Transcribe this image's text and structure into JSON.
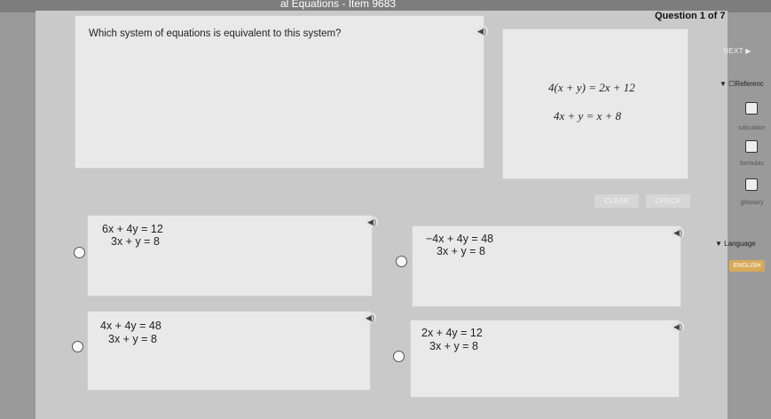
{
  "header": {
    "title": "al Equations - Item 9683",
    "question_counter": "Question 1 of 7"
  },
  "question": {
    "prompt": "Which system of equations is equivalent to this system?",
    "given": {
      "line1": "4(x + y) = 2x + 12",
      "line2": "4x + y = x + 8"
    }
  },
  "options": [
    {
      "line1": "6x + 4y = 12",
      "line2": "3x + y = 8"
    },
    {
      "line1": "−4x + 4y = 48",
      "line2": "3x + y = 8"
    },
    {
      "line1": "4x + 4y = 48",
      "line2": "3x + y = 8"
    },
    {
      "line1": "2x + 4y = 12",
      "line2": "3x + y = 8"
    }
  ],
  "buttons": {
    "next": "NEXT ▶",
    "clear": "CLEAR",
    "check": "CHECK"
  },
  "sidebar": {
    "reference_header": "▼ ☐Referenc",
    "items": [
      {
        "label": "calculator",
        "icon": "calculator-icon"
      },
      {
        "label": "formulas",
        "icon": "formulas-icon"
      },
      {
        "label": "glossary",
        "icon": "glossary-icon"
      }
    ],
    "language_header": "▼ Language",
    "language_value": "ENGLISH"
  },
  "colors": {
    "background": "#9a9a9a",
    "panel": "#c9c9c9",
    "card": "#e9e9e9",
    "language_button": "#d8a95a"
  }
}
